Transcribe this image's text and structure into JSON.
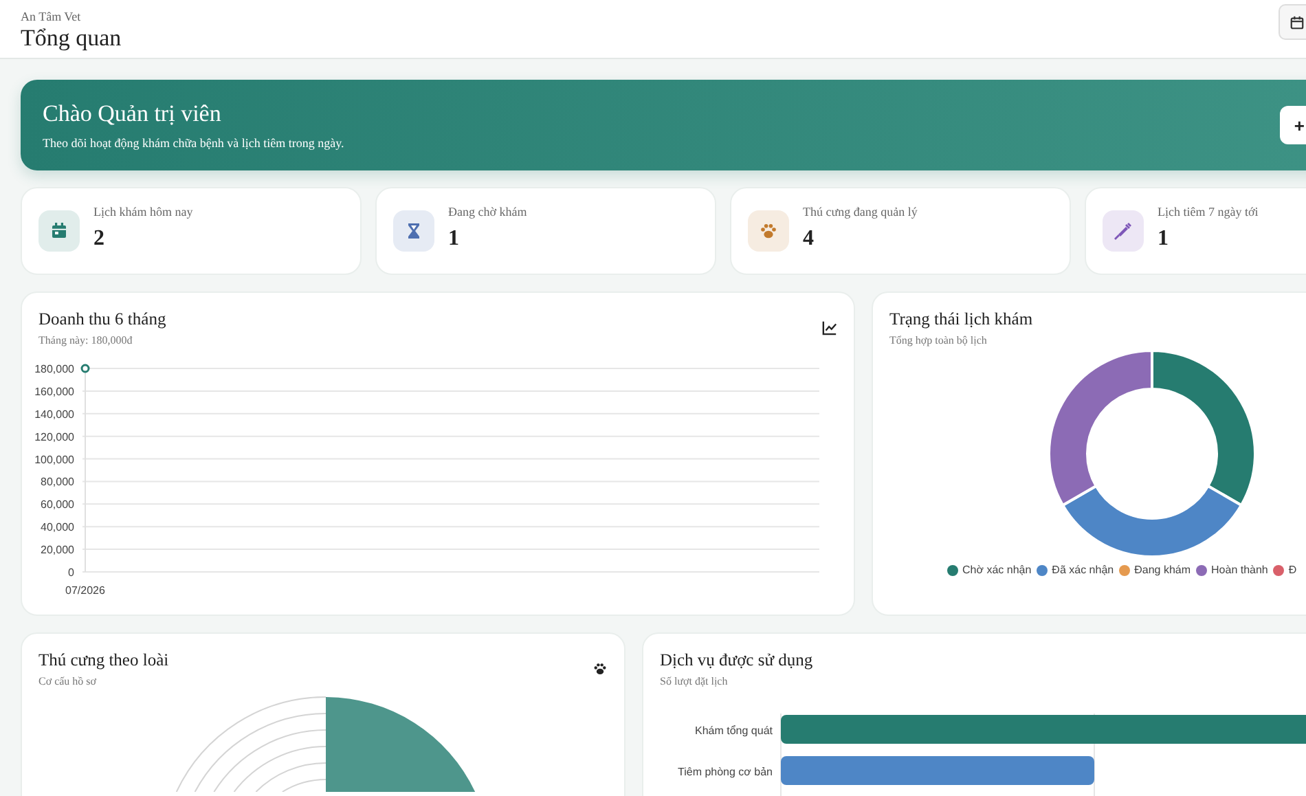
{
  "header": {
    "brand": "An Tâm Vet",
    "title": "Tổng quan"
  },
  "banner": {
    "title": "Chào Quản trị viên",
    "subtitle": "Theo dõi hoạt động khám chữa bệnh và lịch tiêm trong ngày.",
    "button": "+"
  },
  "stats": [
    {
      "label": "Lịch khám hôm nay",
      "value": "2",
      "color": "#267c70"
    },
    {
      "label": "Đang chờ khám",
      "value": "1",
      "color": "#4e6fb0"
    },
    {
      "label": "Thú cưng đang quản lý",
      "value": "4",
      "color": "#c27a2c"
    },
    {
      "label": "Lịch tiêm 7 ngày tới",
      "value": "1",
      "color": "#7e57b8"
    }
  ],
  "revenue": {
    "title": "Doanh thu 6 tháng",
    "subtitle": "Tháng này: 180,000đ",
    "chart_data": {
      "type": "line",
      "categories": [
        "07/2026"
      ],
      "series": [
        {
          "color": "#267c70",
          "marker": true,
          "values": [
            180000
          ]
        }
      ],
      "grid": true,
      "ylim": [
        0,
        180000
      ],
      "yticks": [
        {
          "value": 0,
          "label": "0"
        },
        {
          "value": 20000,
          "label": "20,000"
        },
        {
          "value": 40000,
          "label": "40,000"
        },
        {
          "value": 60000,
          "label": "60,000"
        },
        {
          "value": 80000,
          "label": "80,000"
        },
        {
          "value": 100000,
          "label": "100,000"
        },
        {
          "value": 120000,
          "label": "120,000"
        },
        {
          "value": 140000,
          "label": "140,000"
        },
        {
          "value": 160000,
          "label": "160,000"
        },
        {
          "value": 180000,
          "label": "180,000"
        }
      ]
    }
  },
  "status": {
    "title": "Trạng thái lịch khám",
    "subtitle": "Tổng hợp toàn bộ lịch",
    "chart_data": {
      "type": "donut",
      "categories": [
        "Chờ xác nhận",
        "Đã xác nhận",
        "Đang khám",
        "Hoàn thành",
        "Đ"
      ],
      "series": [
        {
          "colors": [
            "#267c70",
            "#4e86c6",
            "#e59a4f",
            "#8c6bb5",
            "#d9606a"
          ],
          "values": [
            33.33,
            33.33,
            0,
            33.34,
            0
          ]
        }
      ],
      "legend": "bottom"
    }
  },
  "species": {
    "title": "Thú cưng theo loài",
    "subtitle": "Cơ cấu hồ sơ"
  },
  "services": {
    "title": "Dịch vụ được sử dụng",
    "subtitle": "Số lượt đặt lịch",
    "bars": [
      {
        "label": "Khám tổng quát",
        "color": "#267c70"
      },
      {
        "label": "Tiêm phòng cơ bản",
        "color": "#4e86c6"
      }
    ]
  }
}
